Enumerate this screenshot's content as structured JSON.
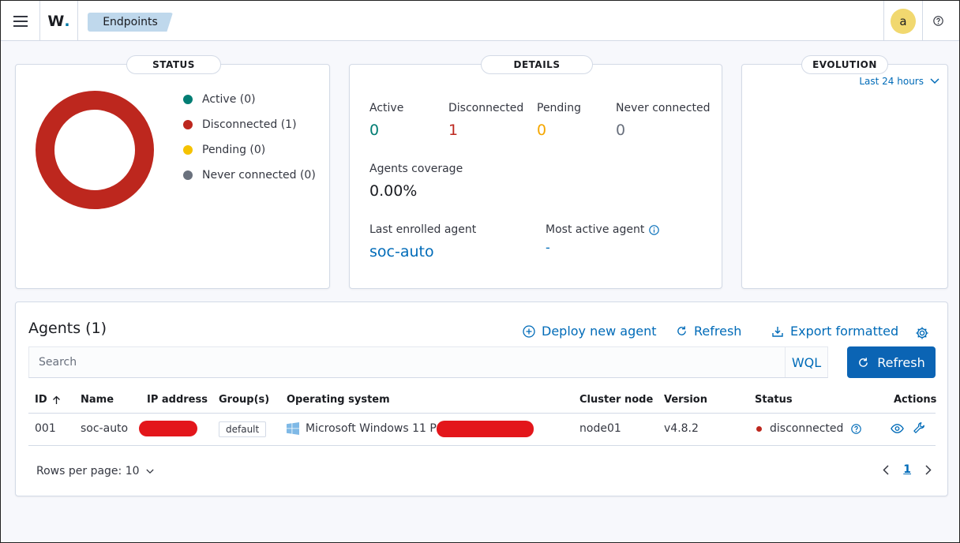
{
  "header": {
    "logo_letter": "W",
    "logo_dot": ".",
    "breadcrumb": "Endpoints",
    "avatar_initial": "a"
  },
  "status_panel": {
    "title": "STATUS",
    "legend": [
      {
        "label": "Active (0)",
        "color": "#017d73"
      },
      {
        "label": "Disconnected (1)",
        "color": "#bd271e"
      },
      {
        "label": "Pending (0)",
        "color": "#f5a700"
      },
      {
        "label": "Never connected (0)",
        "color": "#6a717d"
      }
    ],
    "donut_color": "#bd271e"
  },
  "details_panel": {
    "title": "DETAILS",
    "active_label": "Active",
    "active_value": "0",
    "disconnected_label": "Disconnected",
    "disconnected_value": "1",
    "pending_label": "Pending",
    "pending_value": "0",
    "never_label": "Never connected",
    "never_value": "0",
    "coverage_label": "Agents coverage",
    "coverage_value": "0.00%",
    "last_enrolled_label": "Last enrolled agent",
    "last_enrolled_value": "soc-auto",
    "most_active_label": "Most active agent",
    "most_active_value": "-"
  },
  "evolution_panel": {
    "title": "EVOLUTION",
    "range": "Last 24 hours"
  },
  "agents": {
    "title": "Agents (1)",
    "deploy_label": "Deploy new agent",
    "refresh_link_label": "Refresh",
    "export_label": "Export formatted",
    "search_placeholder": "Search",
    "wql_label": "WQL",
    "refresh_button_label": "Refresh",
    "columns": {
      "id": "ID",
      "name": "Name",
      "ip": "IP address",
      "groups": "Group(s)",
      "os": "Operating system",
      "cluster": "Cluster node",
      "version": "Version",
      "status": "Status",
      "actions": "Actions"
    },
    "row": {
      "id": "001",
      "name": "soc-auto",
      "group": "default",
      "os": "Microsoft Windows 11 Pro",
      "cluster": "node01",
      "version": "v4.8.2",
      "status": "disconnected"
    },
    "rows_per_page": "Rows per page: 10",
    "current_page": "1"
  }
}
